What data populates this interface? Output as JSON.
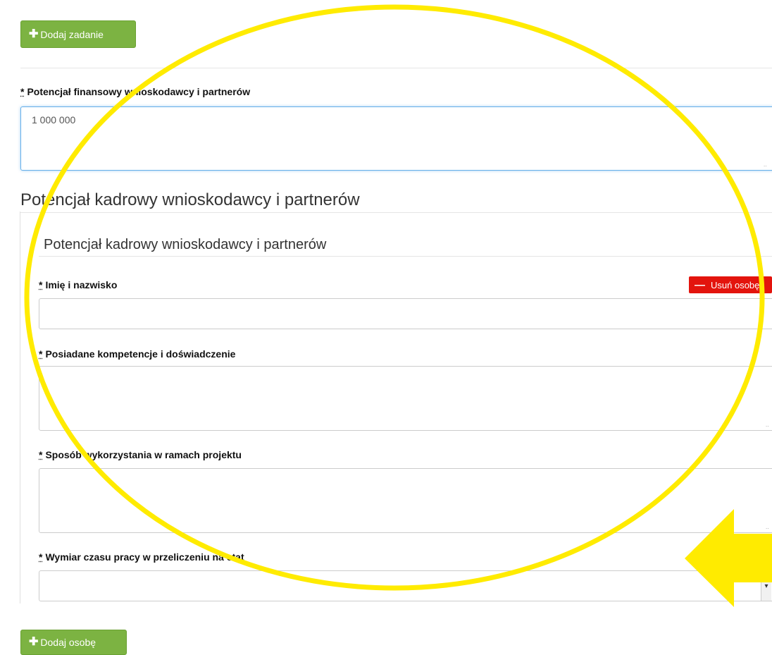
{
  "top_button": {
    "label": "Dodaj zadanie"
  },
  "financial": {
    "required_mark": "*",
    "label": "Potencjał finansowy wnioskodawcy i partnerów",
    "value": "1 000 000"
  },
  "staff_section": {
    "title": "Potencjał kadrowy wnioskodawcy i partnerów",
    "person": {
      "title": "Potencjał kadrowy wnioskodawcy i partnerów",
      "remove_label": "Usuń osobę",
      "fields": {
        "name": {
          "required_mark": "*",
          "label": "Imię i nazwisko",
          "value": ""
        },
        "competence": {
          "required_mark": "*",
          "label": "Posiadane kompetencje i doświadczenie",
          "value": ""
        },
        "usage": {
          "required_mark": "*",
          "label": "Sposób wykorzystania w ramach projektu",
          "value": ""
        },
        "worktime": {
          "required_mark": "*",
          "label": "Wymiar czasu pracy w przeliczeniu na etat",
          "value": ""
        }
      }
    }
  },
  "bottom_button": {
    "label": "Dodaj osobę"
  },
  "annotation": {
    "color": "#ffeb00",
    "shapes": [
      "ellipse-highlight",
      "arrow-left"
    ]
  }
}
